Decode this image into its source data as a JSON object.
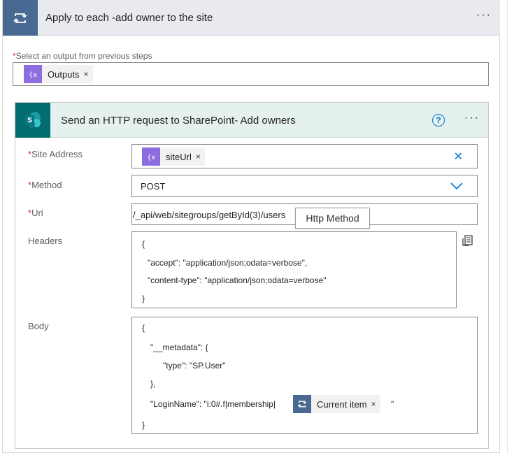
{
  "loop": {
    "title": "Apply to each -add owner to the site",
    "more_label": "···",
    "select_label": "Select an output from previous steps",
    "required_mark": "*",
    "outputs_token": "Outputs",
    "token_close": "×"
  },
  "action": {
    "title": "Send an HTTP request to SharePoint- Add owners",
    "help_glyph": "?",
    "more_label": "···",
    "site_address": {
      "label": "Site Address",
      "token": "siteUrl",
      "clear_glyph": "✕"
    },
    "method": {
      "label": "Method",
      "value": "POST"
    },
    "uri": {
      "label": "Uri",
      "value": "/_api/web/sitegroups/getById(3)/users"
    },
    "headers": {
      "label": "Headers",
      "lines": [
        "{",
        "\"accept\": \"application/json;odata=verbose\",",
        "\"content-type\": \"application/json;odata=verbose\"",
        "}"
      ]
    },
    "body": {
      "label": "Body",
      "lines": [
        "{",
        "\"__metadata\": {",
        "\"type\": \"SP.User\"",
        "},",
        "\"LoginName\": \"i:0#.f|membership|",
        "}"
      ],
      "token": "Current item",
      "after_token": "\""
    }
  },
  "tooltip": {
    "text": "Http Method"
  },
  "colors": {
    "loop_accent": "#486991",
    "sharepoint_accent": "#036c70",
    "expression_token": "#8c6cde",
    "help_blue": "#0078d4",
    "required": "#c4314b"
  },
  "icons": {
    "loop": "loop-icon",
    "sharepoint": "sharepoint-icon",
    "expression": "expression-icon",
    "help": "help-icon",
    "dropdown": "chevron-down-icon",
    "clear": "close-icon",
    "switch_to_text": "switch-text-mode-icon"
  }
}
